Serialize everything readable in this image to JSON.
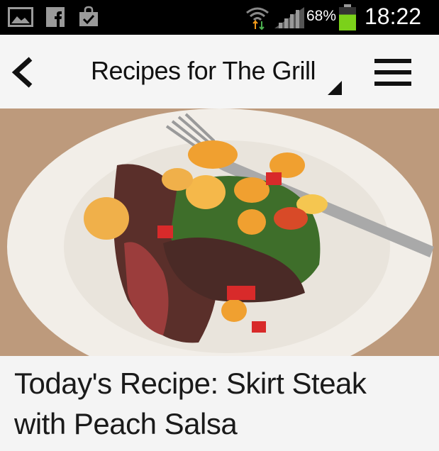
{
  "status_bar": {
    "battery_percent": "68%",
    "time": "18:22",
    "battery_level": 0.68,
    "battery_color": "#7bd11a",
    "icons": [
      "gallery-icon",
      "facebook-icon",
      "shopping-bag-check-icon",
      "wifi-data-icon",
      "signal-icon",
      "battery-icon"
    ]
  },
  "app_bar": {
    "title": "Recipes for The Grill",
    "icons": [
      "back-arrow-icon",
      "dropdown-indicator-icon",
      "hamburger-menu-icon"
    ]
  },
  "article": {
    "headline": "Today's Recipe: Skirt Steak with Peach Salsa",
    "image_subject": "skirt-steak-with-peach-salsa-photo"
  }
}
